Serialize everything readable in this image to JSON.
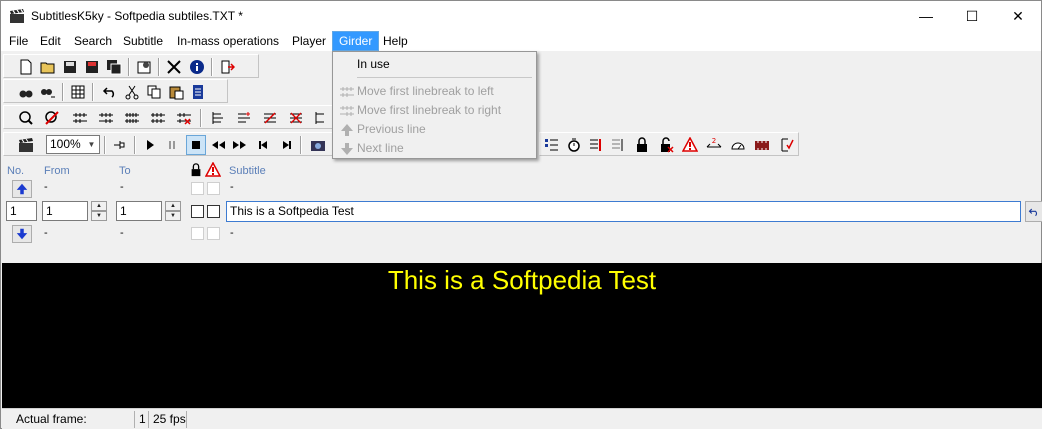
{
  "window": {
    "title": "SubtitlesK5ky - Softpedia subtiles.TXT *",
    "min_glyph": "—",
    "max_glyph": "☐",
    "close_glyph": "✕"
  },
  "menu": [
    {
      "label": "File"
    },
    {
      "label": "Edit"
    },
    {
      "label": "Search"
    },
    {
      "label": "Subtitle"
    },
    {
      "label": "In-mass operations"
    },
    {
      "label": "Player"
    },
    {
      "label": "Girder"
    },
    {
      "label": "Help"
    }
  ],
  "girder_menu": {
    "items": [
      {
        "label": "In use",
        "enabled": true
      },
      {
        "label": "Move first linebreak to left",
        "enabled": false
      },
      {
        "label": "Move first linebreak to right",
        "enabled": false
      },
      {
        "label": "Previous line",
        "enabled": false
      },
      {
        "label": "Next line",
        "enabled": false
      }
    ]
  },
  "toolbar": {
    "zoom_value": "100%"
  },
  "editor": {
    "headers": {
      "no": "No.",
      "from": "From",
      "to": "To",
      "subtitle": "Subtitle"
    },
    "dash": "-",
    "current": {
      "no": "1",
      "from": "1",
      "to": "1",
      "text": "This is a Softpedia Test"
    }
  },
  "video": {
    "subtitle_text": "This is a Softpedia Test",
    "subtitle_color": "#ffff00"
  },
  "statusbar": {
    "label": "Actual frame:",
    "frame": "1",
    "fps": "25 fps"
  },
  "colors": {
    "accent": "#3399ff",
    "header_label": "#5b7fb8",
    "video_bg": "#000000"
  }
}
